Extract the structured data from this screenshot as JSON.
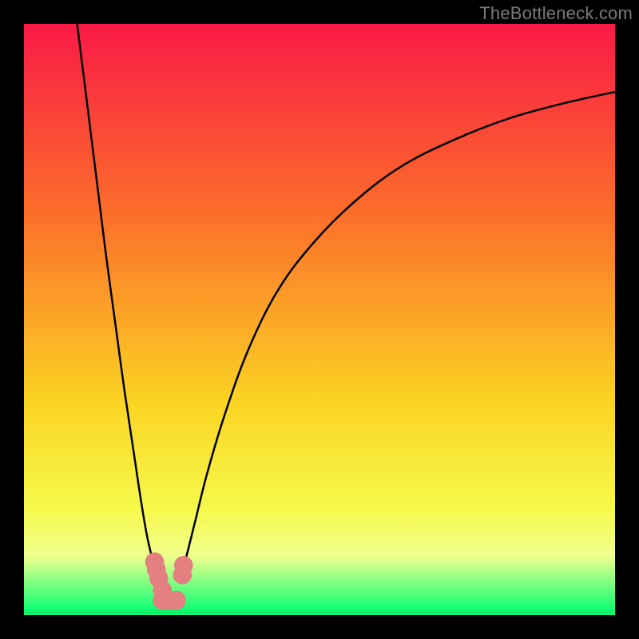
{
  "watermark": "TheBottleneck.com",
  "chart_data": {
    "type": "line",
    "title": "",
    "xlabel": "",
    "ylabel": "",
    "xlim": [
      0,
      100
    ],
    "ylim": [
      0,
      100
    ],
    "grid": false,
    "legend": false,
    "series": [
      {
        "name": "left-curve",
        "x": [
          9.0,
          10.5,
          12.5,
          14.0,
          15.5,
          17.0,
          18.5,
          19.7,
          20.7,
          21.6,
          22.3,
          22.8
        ],
        "y": [
          100.0,
          88.0,
          72.0,
          60.0,
          49.0,
          38.0,
          28.0,
          20.0,
          14.0,
          10.0,
          8.0,
          6.5
        ]
      },
      {
        "name": "right-curve",
        "x": [
          26.5,
          27.5,
          29.0,
          31.0,
          34.0,
          38.0,
          43.0,
          49.0,
          56.0,
          64.0,
          73.0,
          82.0,
          91.0,
          100.0
        ],
        "y": [
          6.5,
          10.0,
          16.0,
          24.0,
          34.0,
          45.0,
          55.0,
          63.0,
          70.0,
          76.0,
          80.5,
          84.0,
          86.5,
          88.5
        ]
      },
      {
        "name": "baseline",
        "x": [
          0,
          100
        ],
        "y": [
          0.6,
          0.6
        ]
      }
    ],
    "markers": [
      {
        "name": "marker",
        "x": 22.1,
        "y": 9.0,
        "r": 1.6
      },
      {
        "name": "marker",
        "x": 22.4,
        "y": 7.7,
        "r": 1.6
      },
      {
        "name": "marker",
        "x": 22.8,
        "y": 6.2,
        "r": 1.6
      },
      {
        "name": "marker",
        "x": 23.4,
        "y": 4.2,
        "r": 1.6
      },
      {
        "name": "marker",
        "x": 23.4,
        "y": 2.5,
        "r": 1.6
      },
      {
        "name": "marker",
        "x": 24.6,
        "y": 2.5,
        "r": 1.6
      },
      {
        "name": "marker",
        "x": 25.8,
        "y": 2.5,
        "r": 1.6
      },
      {
        "name": "marker",
        "x": 26.8,
        "y": 6.8,
        "r": 1.6
      },
      {
        "name": "marker",
        "x": 27.0,
        "y": 8.4,
        "r": 1.6
      }
    ],
    "colors": {
      "gradient_top": "#fa1a46",
      "gradient_mid1": "#fb6e2a",
      "gradient_mid2": "#fbd423",
      "gradient_mid3": "#f6f94b",
      "gradient_band": "#f0ff8e",
      "gradient_bottom": "#11ff74",
      "curve": "#000000",
      "marker": "#e58080",
      "baseline": "#0df768"
    }
  }
}
